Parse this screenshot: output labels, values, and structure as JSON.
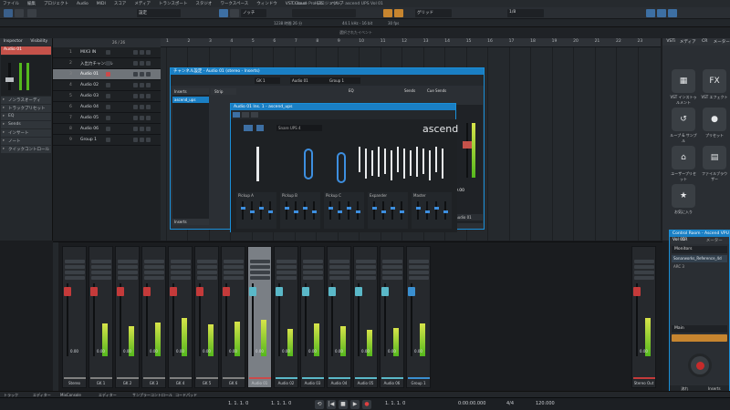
{
  "window_title": "Cubase Pro プロジェクト - ascend UPS Vol 01",
  "menu": [
    "ファイル",
    "編集",
    "プロジェクト",
    "Audio",
    "MIDI",
    "スコア",
    "メディア",
    "トランスポート",
    "スタジオ",
    "ワークスペース",
    "ウィンドウ",
    "VST Cloud",
    "Hub",
    "ヘルプ"
  ],
  "toolbar": {
    "preset": "設定",
    "snap_mode": "グリッド",
    "quantize": "1/8",
    "tool_readout": "ノッチ"
  },
  "status": {
    "rate": "44.1 kHz - 16 bit",
    "rec_time": "1238 時間 26 分",
    "fps": "30 fps",
    "latency": "1/8"
  },
  "info_line": "選択されたイベント",
  "left_zone": {
    "tabs": [
      "Inspector",
      "Visibility"
    ],
    "track_name": "Audio 01",
    "sections": [
      "ノンラスオーディ",
      "トラックプリセット",
      "EQ",
      "Sends",
      "インサート",
      "ノート",
      "クイックコントロール"
    ]
  },
  "tracks": [
    {
      "label": "MIX3 IN",
      "color": "#3a3f44"
    },
    {
      "label": "入出力チャンネル",
      "color": "#3a3f44"
    },
    {
      "label": "Audio 01",
      "color": "#cc4a4a",
      "selected": true
    },
    {
      "label": "Audio 02",
      "color": "#3a3f44"
    },
    {
      "label": "Audio 03",
      "color": "#3a3f44"
    },
    {
      "label": "Audio 04",
      "color": "#3a3f44"
    },
    {
      "label": "Audio 05",
      "color": "#3a3f44"
    },
    {
      "label": "Audio 06",
      "color": "#3a3f44"
    },
    {
      "label": "Group 1",
      "color": "#3a3f44"
    }
  ],
  "track_count": "26 / 26",
  "ruler": [
    "1",
    "2",
    "3",
    "4",
    "5",
    "6",
    "7",
    "8",
    "9",
    "10",
    "11",
    "12",
    "13",
    "14",
    "15",
    "16",
    "17",
    "18",
    "19",
    "20",
    "21",
    "22",
    "23"
  ],
  "channel_window": {
    "title": "チャンネル設定 - Audio 01 (stereo - Inserts)",
    "channel": "Audio 01",
    "group": "Group 1",
    "tabs": [
      "Inserts",
      "Strip",
      "EQ",
      "Sends",
      "Cue Sends"
    ],
    "insert_slot": "ascend_ups",
    "bottom_tabs": [
      "Inserts",
      "ルーティング"
    ],
    "volume": "0.00"
  },
  "plugin_window": {
    "title": "Audio 01 Ins. 1 - ascend_ups",
    "brand": "ascend",
    "mode": "Snare UPS 4",
    "param_labels": [
      "Pickup A",
      "Pickup B",
      "Pickup C",
      "Expander",
      "Master"
    ],
    "knob_labels": [
      "Attk",
      "Rel",
      "Fd",
      "Ratio",
      "Tone",
      "Gain"
    ]
  },
  "right_zone": {
    "tabs": [
      "VSTi",
      "メディア",
      "CR",
      "メーター"
    ],
    "media": [
      {
        "icon": "▦",
        "label": "VST インストゥルメント"
      },
      {
        "icon": "FX",
        "label": "VST エフェクト"
      },
      {
        "icon": "↺",
        "label": "ループ & サンプル"
      },
      {
        "icon": "●",
        "label": "プリセット"
      },
      {
        "icon": "⌂",
        "label": "ユーザープリセット"
      },
      {
        "icon": "▤",
        "label": "ファイルブラウザー"
      },
      {
        "icon": "★",
        "label": "お気に入り"
      }
    ]
  },
  "control_room": {
    "title": "Control Room - Ascend VPU Vol 01",
    "tabs": [
      "CR",
      "メーター"
    ],
    "section": "Monitors",
    "monitor": "Sonarworks_Reference_4d",
    "sub": "ARC 3",
    "main_label": "Main",
    "bottom": [
      "流れ",
      "Inserts"
    ]
  },
  "mixer": {
    "strips": [
      {
        "name": "Stereo",
        "vol": "0.00",
        "color": "#808080",
        "cap": "#c43a3a",
        "level": 0.0
      },
      {
        "name": "GK 1",
        "vol": "0.00",
        "color": "#808080",
        "cap": "#c43a3a",
        "level": 0.6
      },
      {
        "name": "GK 2",
        "vol": "0.00",
        "color": "#808080",
        "cap": "#c43a3a",
        "level": 0.55
      },
      {
        "name": "GK 3",
        "vol": "0.00",
        "color": "#808080",
        "cap": "#c43a3a",
        "level": 0.62
      },
      {
        "name": "GK 4",
        "vol": "0.00",
        "color": "#808080",
        "cap": "#c43a3a",
        "level": 0.7
      },
      {
        "name": "GK 5",
        "vol": "0.00",
        "color": "#808080",
        "cap": "#c43a3a",
        "level": 0.58
      },
      {
        "name": "GK 6",
        "vol": "0.00",
        "color": "#808080",
        "cap": "#c43a3a",
        "level": 0.64
      },
      {
        "name": "Audio 01",
        "vol": "0.00",
        "color": "#cc4a4a",
        "cap": "#5ab8c8",
        "level": 0.66,
        "selected": true
      },
      {
        "name": "Audio 02",
        "vol": "0.00",
        "color": "#5ab8c8",
        "cap": "#5ab8c8",
        "level": 0.5
      },
      {
        "name": "Audio 03",
        "vol": "0.00",
        "color": "#5ab8c8",
        "cap": "#5ab8c8",
        "level": 0.6
      },
      {
        "name": "Audio 04",
        "vol": "0.00",
        "color": "#5ab8c8",
        "cap": "#5ab8c8",
        "level": 0.55
      },
      {
        "name": "Audio 05",
        "vol": "0.00",
        "color": "#5ab8c8",
        "cap": "#5ab8c8",
        "level": 0.48
      },
      {
        "name": "Audio 06",
        "vol": "0.00",
        "color": "#5ab8c8",
        "cap": "#5ab8c8",
        "level": 0.52
      },
      {
        "name": "Group 1",
        "vol": "0.00",
        "color": "#3a8fd0",
        "cap": "#3a8fd0",
        "level": 0.6
      },
      {
        "name": "Stereo Out",
        "vol": "0.00",
        "color": "#c43a3a",
        "cap": "#c43a3a",
        "level": 0.7
      }
    ]
  },
  "bottom_tabs": [
    "トラック",
    "エディター",
    "MixConsole",
    "エディター",
    "サンプラーコントロール",
    "コードパッド"
  ],
  "transport": {
    "left_pos": "1. 1. 1. 0",
    "right_pos": "1. 1. 1. 0",
    "position": "1. 1. 1. 0",
    "time": "0:00:00.000",
    "signature": "4/4",
    "tempo": "120.000"
  }
}
